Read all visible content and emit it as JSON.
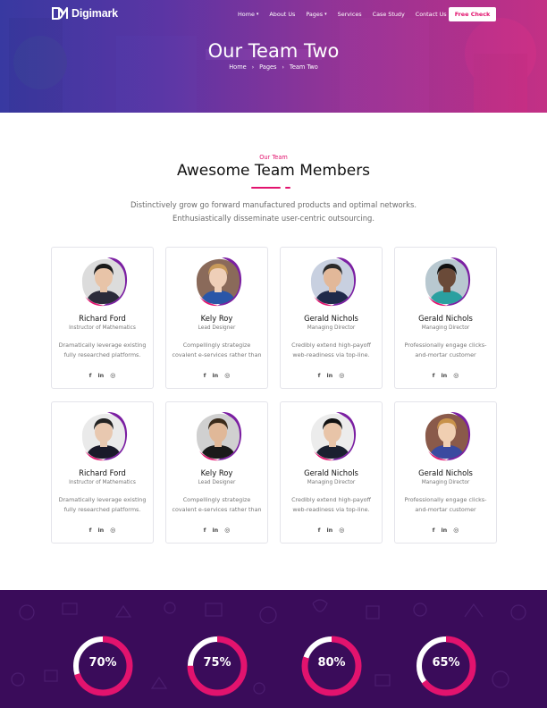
{
  "brand": {
    "name": "Digimark"
  },
  "nav": {
    "items": [
      {
        "label": "Home",
        "dropdown": true
      },
      {
        "label": "About Us",
        "dropdown": false
      },
      {
        "label": "Pages",
        "dropdown": true
      },
      {
        "label": "Services",
        "dropdown": false
      },
      {
        "label": "Case Study",
        "dropdown": false
      },
      {
        "label": "Contact Us",
        "dropdown": false
      }
    ],
    "cta": "Free Check"
  },
  "hero": {
    "title": "Our Team Two",
    "breadcrumb": [
      "Home",
      "Pages",
      "Team Two"
    ]
  },
  "section": {
    "eyebrow": "Our Team",
    "title": "Awesome Team Members",
    "lead_line1": "Distinctively grow go forward manufactured products and optimal networks.",
    "lead_line2": "Enthusiastically disseminate user-centric outsourcing."
  },
  "team": [
    {
      "name": "Richard Ford",
      "role": "Instructor of Mathematics",
      "bio": "Dramatically leverage existing fully researched platforms."
    },
    {
      "name": "Kely Roy",
      "role": "Lead Designer",
      "bio": "Compellingly strategize covalent e-services rather than"
    },
    {
      "name": "Gerald Nichols",
      "role": "Managing Director",
      "bio": "Credibly extend high-payoff web-readiness via top-line."
    },
    {
      "name": "Gerald Nichols",
      "role": "Managing Director",
      "bio": "Professionally engage clicks-and-mortar customer"
    },
    {
      "name": "Richard Ford",
      "role": "Instructor of Mathematics",
      "bio": "Dramatically leverage existing fully researched platforms."
    },
    {
      "name": "Kely Roy",
      "role": "Lead Designer",
      "bio": "Compellingly strategize covalent e-services rather than"
    },
    {
      "name": "Gerald Nichols",
      "role": "Managing Director",
      "bio": "Credibly extend high-payoff web-readiness via top-line."
    },
    {
      "name": "Gerald Nichols",
      "role": "Managing Director",
      "bio": "Professionally engage clicks-and-mortar customer"
    }
  ],
  "socials": {
    "facebook": "f",
    "linkedin": "in",
    "dribbble": "◎"
  },
  "stats": [
    {
      "label": "70%",
      "value": 70
    },
    {
      "label": "75%",
      "value": 75
    },
    {
      "label": "80%",
      "value": 80
    },
    {
      "label": "65%",
      "value": 65
    }
  ],
  "colors": {
    "accent": "#e2136e",
    "purple": "#7b1fa2",
    "dark": "#111111",
    "stats_bg": "#3a0c5a"
  },
  "icons": {
    "logo": "dm-logo-icon",
    "caret": "chevron-down-icon",
    "breadcrumb_sep": "chevron-right-icon",
    "social": [
      "facebook-icon",
      "linkedin-icon",
      "dribbble-icon"
    ]
  }
}
